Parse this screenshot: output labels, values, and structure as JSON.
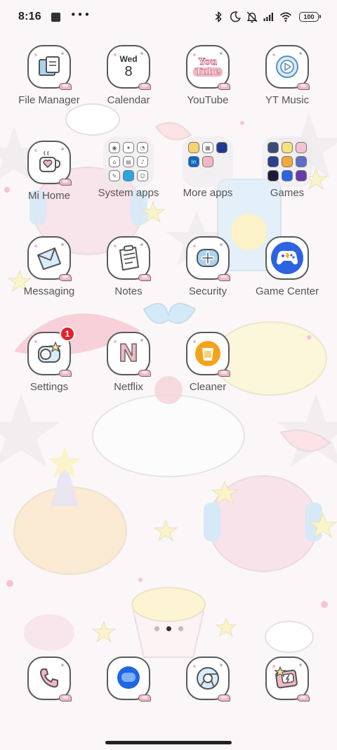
{
  "status_bar": {
    "time": "8:16",
    "overflow": "•••",
    "battery": "100",
    "icons": [
      "bluetooth-icon",
      "moon-icon",
      "bell-muted-icon",
      "signal-icon",
      "wifi-icon",
      "battery-icon"
    ]
  },
  "apps": {
    "file_manager": {
      "label": "File Manager",
      "icon": "folder-document-icon"
    },
    "calendar": {
      "label": "Calendar",
      "day": "Wed",
      "date": "8"
    },
    "youtube": {
      "label": "YouTube",
      "icon_line1": "You",
      "icon_line2": "Tube"
    },
    "yt_music": {
      "label": "YT Music",
      "icon": "play-circle-icon"
    },
    "mi_home": {
      "label": "Mi Home",
      "icon": "heart-mug-icon"
    },
    "messaging": {
      "label": "Messaging",
      "icon": "envelope-icon"
    },
    "notes": {
      "label": "Notes",
      "icon": "clipboard-icon"
    },
    "security": {
      "label": "Security",
      "icon": "shield-plus-icon"
    },
    "game_center": {
      "label": "Game Center",
      "icon": "gamepad-icon"
    },
    "settings": {
      "label": "Settings",
      "badge": "1"
    },
    "netflix": {
      "label": "Netflix",
      "icon_letter": "N"
    },
    "cleaner": {
      "label": "Cleaner",
      "icon": "trash-bin-icon"
    }
  },
  "folders": {
    "system_apps": {
      "label": "System apps"
    },
    "more_apps": {
      "label": "More apps"
    },
    "games": {
      "label": "Games"
    }
  },
  "dock": [
    {
      "name": "phone",
      "icon": "phone-icon"
    },
    {
      "name": "messages",
      "icon": "chat-bubble-icon"
    },
    {
      "name": "chrome",
      "icon": "chrome-icon"
    },
    {
      "name": "gallery",
      "icon": "photo-star-icon"
    }
  ],
  "colors": {
    "accent_blue": "#2d63e0",
    "badge_red": "#e0242a",
    "cleaner_orange": "#f5a31a",
    "pastel_pink": "#f3b7c4",
    "pastel_blue": "#a9d4f1"
  }
}
